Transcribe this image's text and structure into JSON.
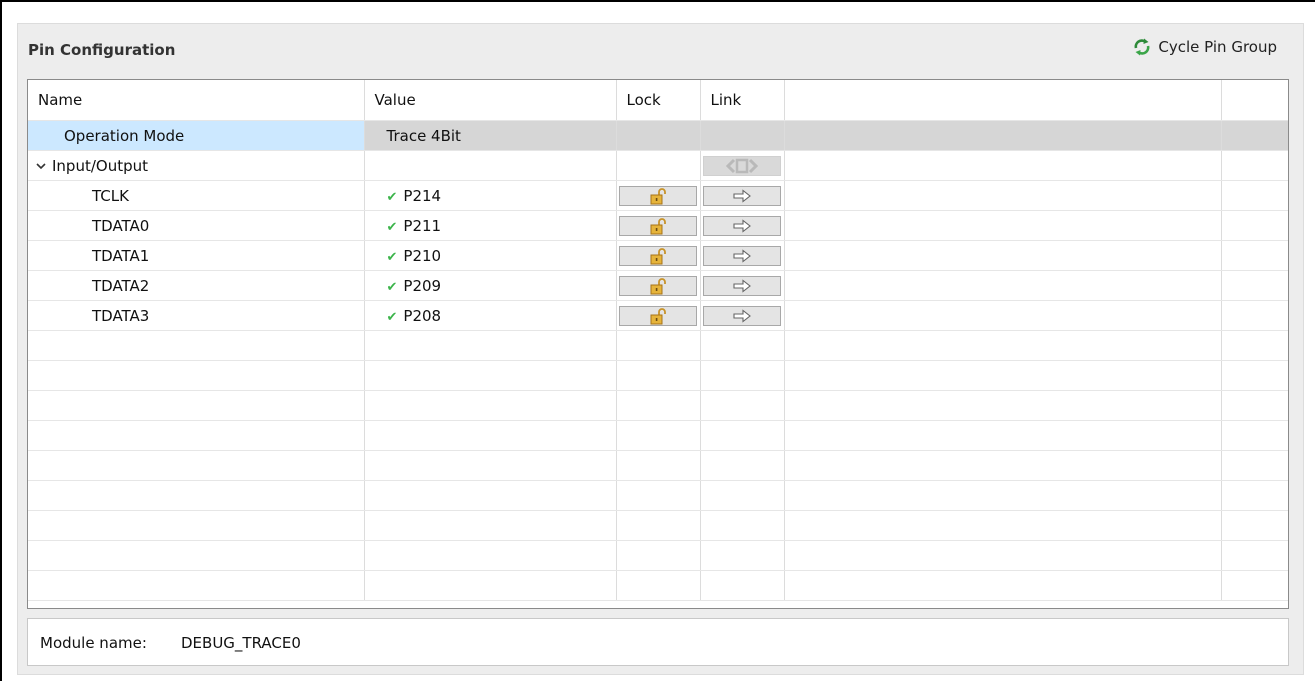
{
  "panel": {
    "title": "Pin Configuration",
    "cycle_button_label": "Cycle Pin Group",
    "cycle_icon": "cycle-arrows-icon"
  },
  "table": {
    "columns": [
      "Name",
      "Value",
      "Lock",
      "Link",
      "",
      ""
    ],
    "rows": [
      {
        "name": "Operation Mode",
        "value": "Trace 4Bit",
        "selected": true
      },
      {
        "name": "Input/Output",
        "value": "",
        "group": true
      },
      {
        "name": "TCLK",
        "value": "P214",
        "status": "check"
      },
      {
        "name": "TDATA0",
        "value": "P211",
        "status": "check"
      },
      {
        "name": "TDATA1",
        "value": "P210",
        "status": "check"
      },
      {
        "name": "TDATA2",
        "value": "P209",
        "status": "check"
      },
      {
        "name": "TDATA3",
        "value": "P208",
        "status": "check"
      }
    ],
    "lock_icon": "unlocked-padlock-icon",
    "link_icon": "right-arrow-icon",
    "group_link_icon": "chevrons-icon"
  },
  "footer": {
    "label": "Module name:",
    "value": "DEBUG_TRACE0"
  },
  "colors": {
    "selection": "#cce8ff",
    "selected_row": "#d6d6d6",
    "check": "#3bb44a",
    "panel_bg": "#ededed"
  }
}
